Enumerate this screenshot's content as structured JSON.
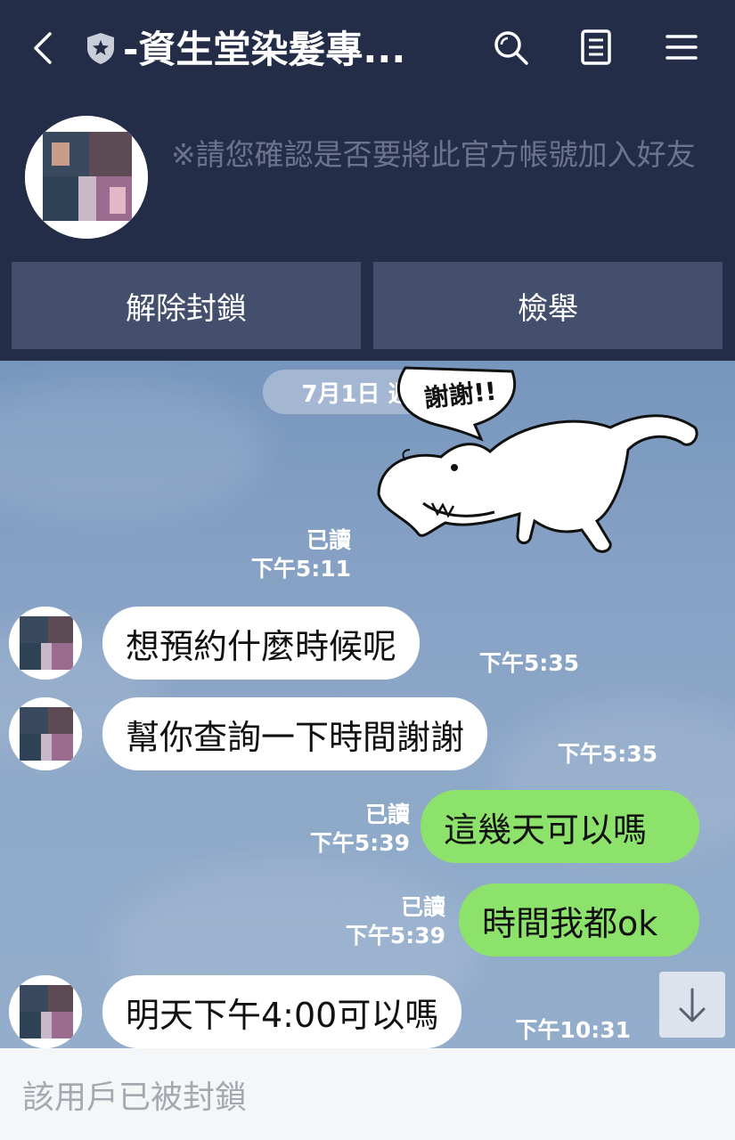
{
  "header": {
    "title": "-資生堂染髮專...",
    "notice": "※請您確認是否要將此官方帳號加入好友",
    "unblock_label": "解除封鎖",
    "report_label": "檢舉"
  },
  "chat": {
    "date": "7月1日 週三",
    "sticker_text": "謝謝!!",
    "sticker_meta": {
      "read": "已讀",
      "time": "下午5:11"
    },
    "messages": [
      {
        "side": "in",
        "text": "想預約什麼時候呢",
        "time": "下午5:35"
      },
      {
        "side": "in",
        "text": "幫你查詢一下時間謝謝",
        "time": "下午5:35"
      },
      {
        "side": "out",
        "text": "這幾天可以嗎",
        "read": "已讀",
        "time": "下午5:39"
      },
      {
        "side": "out",
        "text": "時間我都ok",
        "read": "已讀",
        "time": "下午5:39"
      },
      {
        "side": "in",
        "text": "明天下午4:00可以嗎",
        "time": "下午10:31"
      }
    ]
  },
  "footer": {
    "blocked_text": "該用戶已被封鎖"
  },
  "colors": {
    "header_bg": "#232d48",
    "button_bg": "#434f6c",
    "outgoing_bubble": "#8ce26b",
    "incoming_bubble": "#ffffff"
  },
  "icons": [
    "back-icon",
    "shield-icon",
    "search-icon",
    "notes-icon",
    "menu-icon",
    "arrow-down-icon"
  ]
}
